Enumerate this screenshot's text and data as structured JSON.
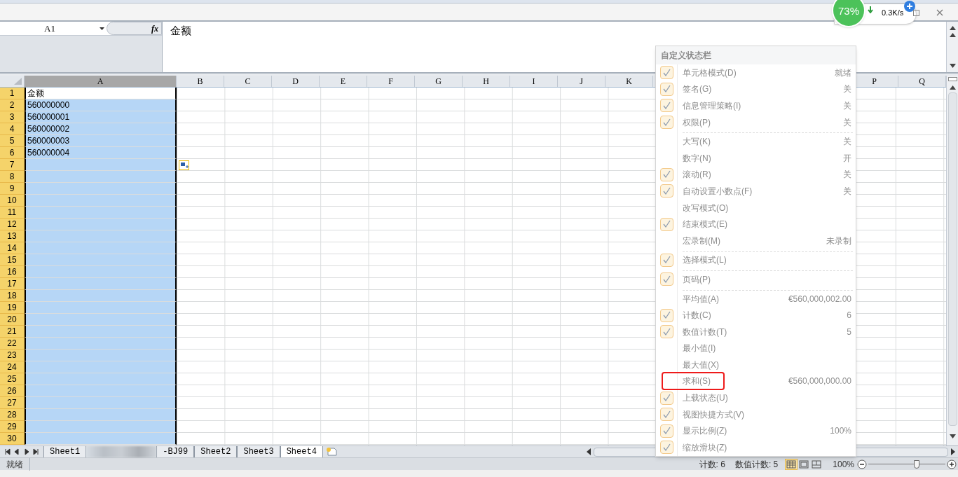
{
  "network_widget": {
    "percent": "73%",
    "speed": "0.3K/s"
  },
  "formula_bar": {
    "name_box": "A1",
    "fx": "fx",
    "content": "金额"
  },
  "columns": [
    {
      "label": "A",
      "selected": true
    },
    {
      "label": "B",
      "selected": false
    },
    {
      "label": "C",
      "selected": false
    },
    {
      "label": "D",
      "selected": false
    },
    {
      "label": "E",
      "selected": false
    },
    {
      "label": "F",
      "selected": false
    },
    {
      "label": "G",
      "selected": false
    },
    {
      "label": "H",
      "selected": false
    },
    {
      "label": "I",
      "selected": false
    },
    {
      "label": "J",
      "selected": false
    },
    {
      "label": "K",
      "selected": false
    }
  ],
  "columns_right": [
    {
      "label": "P",
      "selected": false
    },
    {
      "label": "Q",
      "selected": false
    }
  ],
  "rows": [
    {
      "header": "1",
      "value": "金额",
      "selected": true,
      "active": true
    },
    {
      "header": "2",
      "value": "560000000",
      "selected": true,
      "active": false
    },
    {
      "header": "3",
      "value": "560000001",
      "selected": true,
      "active": false
    },
    {
      "header": "4",
      "value": "560000002",
      "selected": true,
      "active": false
    },
    {
      "header": "5",
      "value": "560000003",
      "selected": true,
      "active": false
    },
    {
      "header": "6",
      "value": "560000004",
      "selected": true,
      "active": false
    },
    {
      "header": "7",
      "selected": true,
      "active": false
    },
    {
      "header": "8",
      "selected": true,
      "active": false
    },
    {
      "header": "9",
      "selected": true,
      "active": false
    },
    {
      "header": "10",
      "selected": true,
      "active": false
    },
    {
      "header": "11",
      "selected": true,
      "active": false
    },
    {
      "header": "12",
      "selected": true,
      "active": false
    },
    {
      "header": "13",
      "selected": true,
      "active": false
    },
    {
      "header": "14",
      "selected": true,
      "active": false
    },
    {
      "header": "15",
      "selected": true,
      "active": false
    },
    {
      "header": "16",
      "selected": true,
      "active": false
    },
    {
      "header": "17",
      "selected": true,
      "active": false
    },
    {
      "header": "18",
      "selected": true,
      "active": false
    },
    {
      "header": "19",
      "selected": true,
      "active": false
    },
    {
      "header": "20",
      "selected": true,
      "active": false
    },
    {
      "header": "21",
      "selected": true,
      "active": false
    },
    {
      "header": "22",
      "selected": true,
      "active": false
    },
    {
      "header": "23",
      "selected": true,
      "active": false
    },
    {
      "header": "24",
      "selected": true,
      "active": false
    },
    {
      "header": "25",
      "selected": true,
      "active": false
    },
    {
      "header": "26",
      "selected": true,
      "active": false
    },
    {
      "header": "27",
      "selected": true,
      "active": false
    },
    {
      "header": "28",
      "selected": true,
      "active": false
    },
    {
      "header": "29",
      "selected": true,
      "active": false
    },
    {
      "header": "30",
      "selected": true,
      "active": false
    }
  ],
  "sheet_tabs": [
    {
      "kind": "tab",
      "label": "Sheet1",
      "selected": false
    },
    {
      "kind": "redacted"
    },
    {
      "kind": "tab",
      "label": "-BJ99",
      "selected": false
    },
    {
      "kind": "tab",
      "label": "Sheet2",
      "selected": false
    },
    {
      "kind": "tab",
      "label": "Sheet3",
      "selected": false
    },
    {
      "kind": "tab",
      "label": "Sheet4",
      "selected": true
    }
  ],
  "status_menu": {
    "title": "自定义状态栏",
    "items": [
      {
        "label": "单元格模式(D)",
        "value": "就绪",
        "checked": true,
        "separator_after": false,
        "highlighted": false
      },
      {
        "label": "签名(G)",
        "value": "关",
        "checked": true,
        "separator_after": false,
        "highlighted": false
      },
      {
        "label": "信息管理策略(I)",
        "value": "关",
        "checked": true,
        "separator_after": false,
        "highlighted": false
      },
      {
        "label": "权限(P)",
        "value": "关",
        "checked": true,
        "separator_after": true,
        "highlighted": false
      },
      {
        "label": "大写(K)",
        "value": "关",
        "checked": false,
        "separator_after": false,
        "highlighted": false
      },
      {
        "label": "数字(N)",
        "value": "开",
        "checked": false,
        "separator_after": false,
        "highlighted": false
      },
      {
        "label": "滚动(R)",
        "value": "关",
        "checked": true,
        "separator_after": false,
        "highlighted": false
      },
      {
        "label": "自动设置小数点(F)",
        "value": "关",
        "checked": true,
        "separator_after": false,
        "highlighted": false
      },
      {
        "label": "改写模式(O)",
        "checked": false,
        "separator_after": false,
        "highlighted": false
      },
      {
        "label": "结束模式(E)",
        "checked": true,
        "separator_after": false,
        "highlighted": false
      },
      {
        "label": "宏录制(M)",
        "value": "未录制",
        "checked": false,
        "separator_after": true,
        "highlighted": false
      },
      {
        "label": "选择模式(L)",
        "checked": true,
        "separator_after": true,
        "highlighted": false
      },
      {
        "label": "页码(P)",
        "checked": true,
        "separator_after": true,
        "highlighted": false
      },
      {
        "label": "平均值(A)",
        "value": "€560,000,002.00",
        "checked": false,
        "separator_after": false,
        "highlighted": false
      },
      {
        "label": "计数(C)",
        "value": "6",
        "checked": true,
        "separator_after": false,
        "highlighted": false
      },
      {
        "label": "数值计数(T)",
        "value": "5",
        "checked": true,
        "separator_after": false,
        "highlighted": false
      },
      {
        "label": "最小值(I)",
        "checked": false,
        "separator_after": false,
        "highlighted": false
      },
      {
        "label": "最大值(X)",
        "checked": false,
        "separator_after": false,
        "highlighted": false
      },
      {
        "label": "求和(S)",
        "value": "€560,000,000.00",
        "checked": false,
        "separator_after": false,
        "highlighted": true
      },
      {
        "label": "上载状态(U)",
        "checked": true,
        "separator_after": false,
        "highlighted": false
      },
      {
        "label": "视图快捷方式(V)",
        "checked": true,
        "separator_after": false,
        "highlighted": false
      },
      {
        "label": "显示比例(Z)",
        "value": "100%",
        "checked": true,
        "separator_after": false,
        "highlighted": false
      },
      {
        "label": "缩放滑块(Z)",
        "checked": true,
        "separator_after": false,
        "highlighted": false
      }
    ]
  },
  "status_bar": {
    "mode": "就绪",
    "count": "计数: 6",
    "numeric_count": "数值计数: 5",
    "views": [
      {
        "kind": "normal",
        "selected": true
      },
      {
        "kind": "layout",
        "selected": false
      },
      {
        "kind": "pagebreak",
        "selected": false
      }
    ],
    "zoom": "100%",
    "zoom_slider": {
      "level": 0.63
    }
  }
}
